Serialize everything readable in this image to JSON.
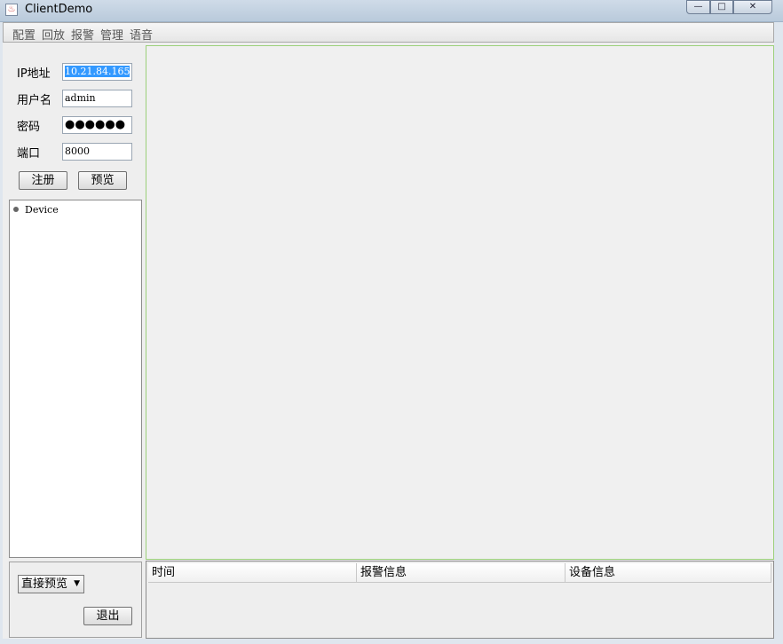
{
  "window": {
    "title": "ClientDemo",
    "controls": {
      "minimize": "—",
      "maximize": "□",
      "close": "✕"
    }
  },
  "menu": {
    "items": [
      "配置",
      "回放",
      "报警",
      "管理",
      "语音"
    ]
  },
  "login": {
    "ip_label": "IP地址",
    "ip_value": "10.21.84.165",
    "user_label": "用户名",
    "user_value": "admin",
    "password_label": "密码",
    "password_value": "●●●●●●",
    "port_label": "端口",
    "port_value": "8000",
    "register_button": "注册",
    "preview_button": "预览"
  },
  "device_tree": {
    "root": "Device"
  },
  "bottom_controls": {
    "preview_mode": "直接预览",
    "exit_button": "退出"
  },
  "alarm_table": {
    "columns": [
      "时间",
      "报警信息",
      "设备信息"
    ],
    "rows": []
  },
  "colors": {
    "selection": "#3399ff",
    "video_border": "#9bd07a"
  },
  "icons": {
    "app": "java-cup-icon",
    "tree_node": "tree-node-icon",
    "combo": "chevron-down-icon"
  }
}
